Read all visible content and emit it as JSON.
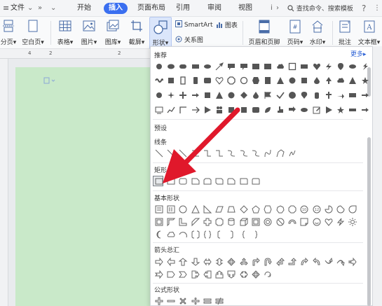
{
  "menubar": {
    "menu_icon": "hamburger-icon",
    "file": "文件",
    "start": "开始",
    "insert": "插入",
    "page_layout": "页面布局",
    "reference": "引用",
    "review": "审阅",
    "view": "视图",
    "search_text": "查找命令、搜索模板",
    "help": "?"
  },
  "ribbon": {
    "page_break": "分页",
    "blank_page": "空白页",
    "table": "表格",
    "picture": "图片",
    "gallery": "图库",
    "screenshot": "截屏",
    "shape": "形状",
    "smartart": "SmartArt",
    "chart": "图表",
    "relation": "关系图",
    "header_footer": "页眉和页脚",
    "page_number": "页码",
    "watermark": "水印",
    "comment": "批注",
    "textbox": "文本框"
  },
  "ruler": {
    "marks": [
      "4",
      "2",
      "2"
    ]
  },
  "panel": {
    "recommend": "推荐",
    "more": "更多",
    "preset": "预设",
    "lines": "线条",
    "rectangle": "矩形",
    "basic": "基本形状",
    "arrows": "箭头总汇",
    "formula": "公式形状"
  },
  "accent_color": "#3a6ff0",
  "arrow_color": "#e0182b"
}
